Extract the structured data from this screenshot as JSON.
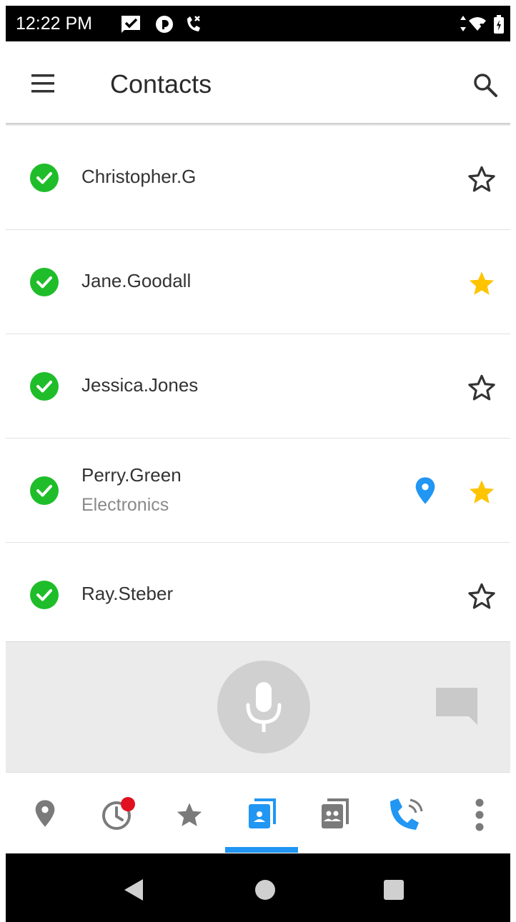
{
  "status_bar": {
    "time": "12:22 PM",
    "icons": [
      "message-check-icon",
      "app-badge-icon",
      "missed-call-icon",
      "data-arrows-icon",
      "wifi-icon",
      "battery-icon"
    ]
  },
  "app_bar": {
    "title": "Contacts",
    "menu_icon": "hamburger-menu-icon",
    "search_icon": "search-icon"
  },
  "contacts": [
    {
      "name": "Christopher.G",
      "subtitle": "",
      "presence": "available",
      "favorite": false,
      "has_location": false
    },
    {
      "name": "Jane.Goodall",
      "subtitle": "",
      "presence": "available",
      "favorite": true,
      "has_location": false
    },
    {
      "name": "Jessica.Jones",
      "subtitle": "",
      "presence": "available",
      "favorite": false,
      "has_location": false
    },
    {
      "name": "Perry.Green",
      "subtitle": "Electronics",
      "presence": "available",
      "favorite": true,
      "has_location": true
    },
    {
      "name": "Ray.Steber",
      "subtitle": "",
      "presence": "available",
      "favorite": false,
      "has_location": false
    }
  ],
  "voice_bar": {
    "mic_icon": "microphone-icon",
    "chat_icon": "chat-icon"
  },
  "tabs": [
    {
      "icon": "location-pin-icon",
      "active": false
    },
    {
      "icon": "recent-clock-icon",
      "active": false,
      "badge": true
    },
    {
      "icon": "favorites-star-icon",
      "active": false
    },
    {
      "icon": "contacts-book-icon",
      "active": true
    },
    {
      "icon": "groups-book-icon",
      "active": false
    },
    {
      "icon": "ptt-call-icon",
      "active": false
    },
    {
      "icon": "more-vert-icon",
      "active": false
    }
  ],
  "nav_bar": {
    "buttons": [
      "back-triangle-icon",
      "home-circle-icon",
      "recents-square-icon"
    ]
  },
  "colors": {
    "presence_green": "#1fbd2a",
    "favorite_gold": "#ffc400",
    "accent_blue": "#2196f3",
    "icon_gray": "#7a7a7a",
    "badge_red": "#e01020"
  }
}
